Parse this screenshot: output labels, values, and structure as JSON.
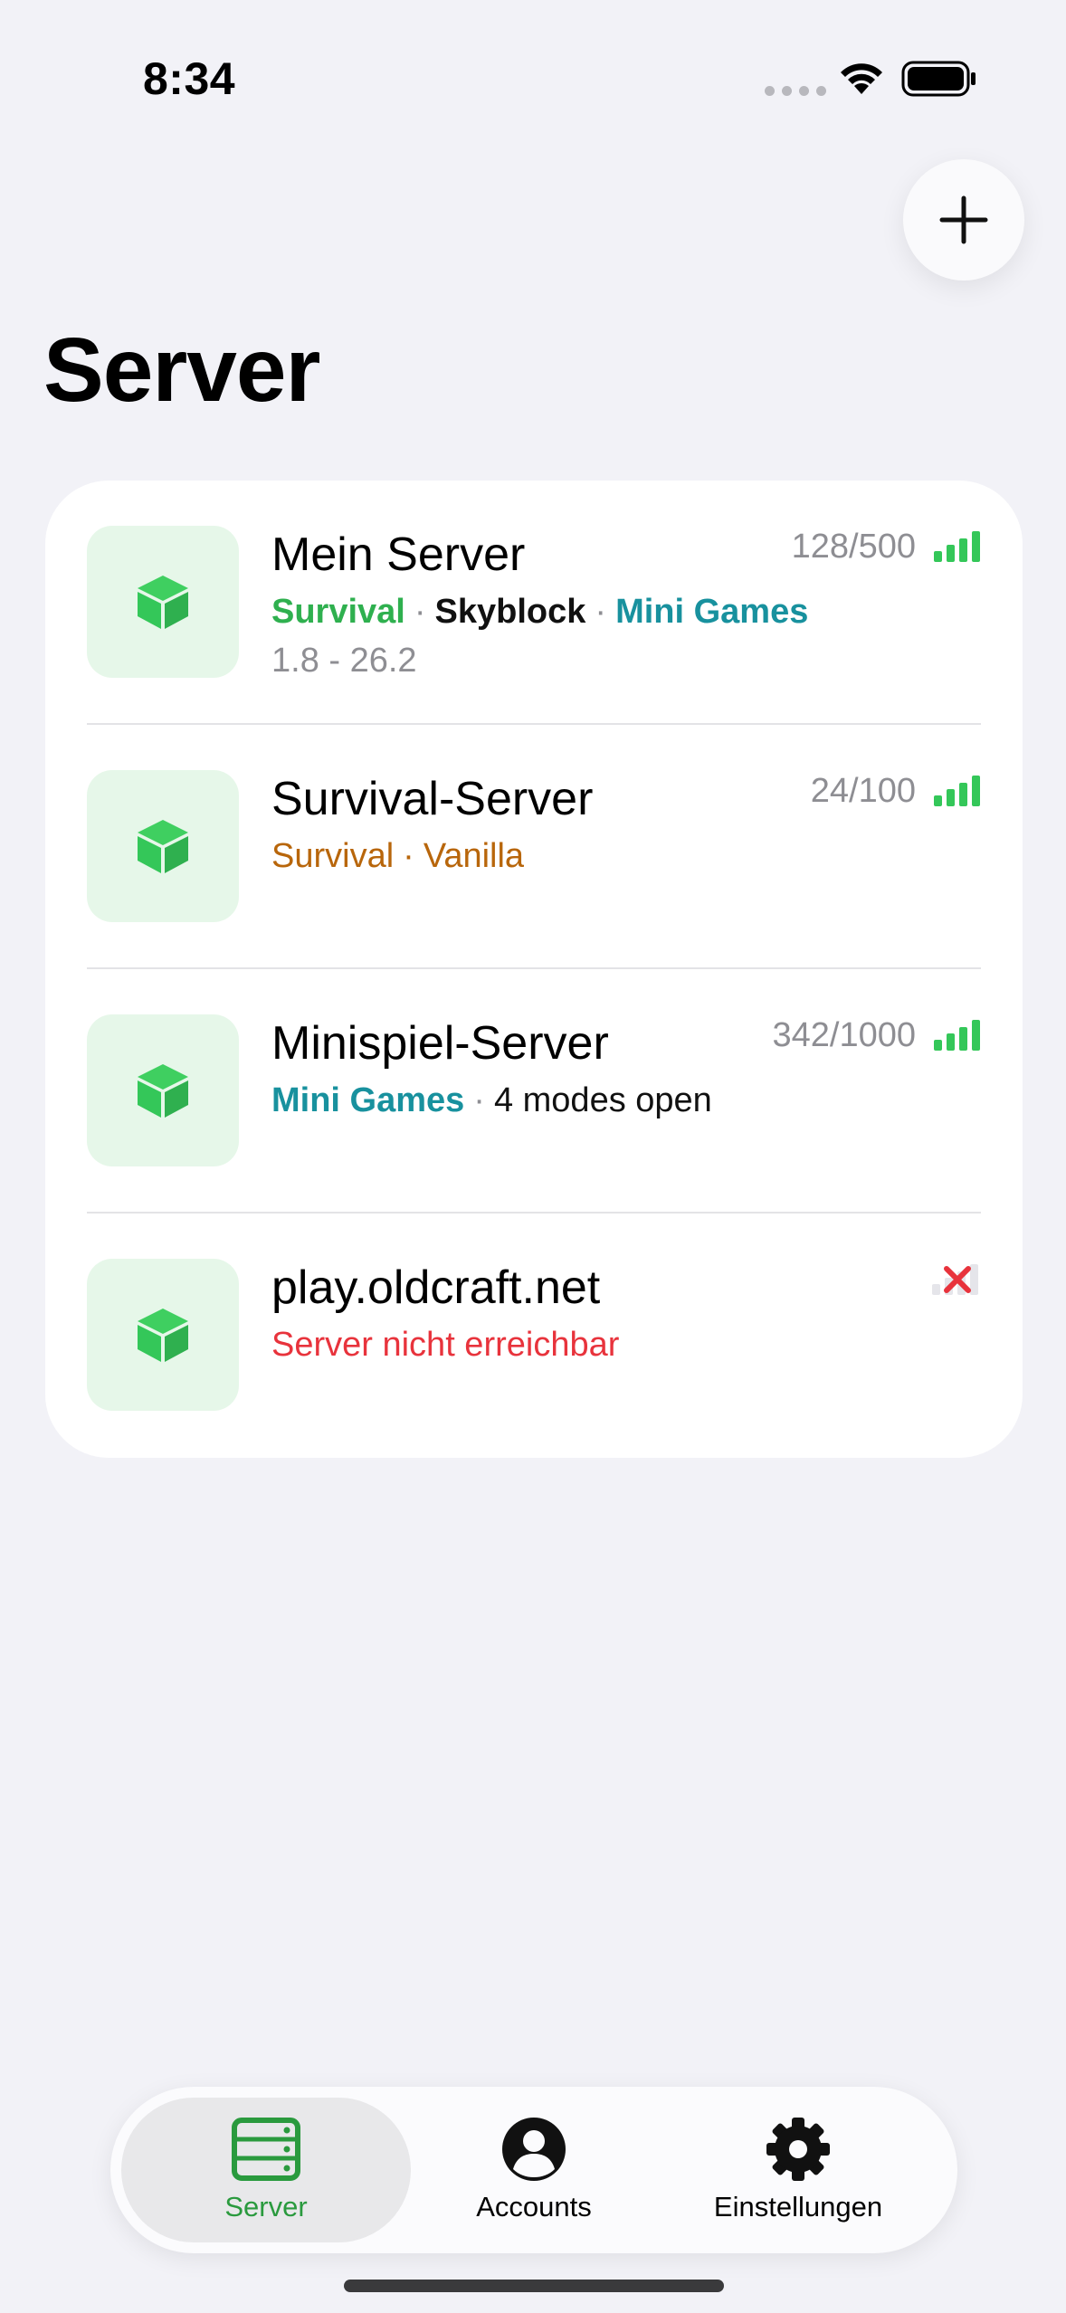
{
  "status_bar": {
    "time": "8:34"
  },
  "header": {
    "title": "Server",
    "add_icon": "plus-icon"
  },
  "colors": {
    "accent_green": "#2fb04f",
    "tag_teal": "#18919e",
    "tag_orange": "#b8660b",
    "error_red": "#e8333c",
    "icon_bg": "#e6f7e9"
  },
  "servers": [
    {
      "name": "Mein Server",
      "players": "128/500",
      "tags": [
        "Survival",
        "Skyblock",
        "Mini Games"
      ],
      "version": "1.8 - 26.2",
      "status": "online"
    },
    {
      "name": "Survival-Server",
      "players": "24/100",
      "tags": [
        "Survival",
        "Vanilla"
      ],
      "status": "online"
    },
    {
      "name": "Minispiel-Server",
      "players": "342/1000",
      "tags": [
        "Mini Games",
        "4 modes open"
      ],
      "status": "online"
    },
    {
      "name": "play.oldcraft.net",
      "error": "Server nicht erreichbar",
      "status": "offline"
    }
  ],
  "tab_bar": {
    "items": [
      {
        "label": "Server",
        "icon": "server-rack-icon",
        "active": true
      },
      {
        "label": "Accounts",
        "icon": "person-circle-icon",
        "active": false
      },
      {
        "label": "Einstellungen",
        "icon": "gear-icon",
        "active": false
      }
    ]
  }
}
